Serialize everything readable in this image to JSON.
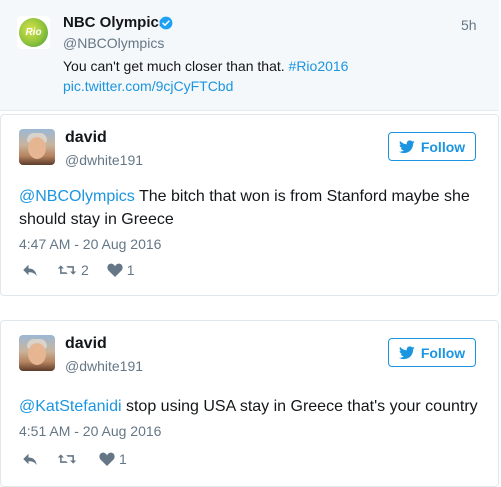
{
  "quoted_tweet": {
    "name": "NBC Olympics",
    "handle": "@NBCOlympics",
    "time": "5h",
    "text": "You can't get much closer than that. ",
    "hashtag": "#Rio2016",
    "link": "pic.twitter.com/9cjCyFTCbd",
    "avatar_text": "Rio"
  },
  "tweets": [
    {
      "name": "david",
      "handle": "@dwhite191",
      "follow_label": "Follow",
      "mention": "@NBCOlympics",
      "text": " The bitch that won is from Stanford maybe she should stay in Greece",
      "timestamp": "4:47 AM - 20 Aug 2016",
      "retweets": "2",
      "likes": "1"
    },
    {
      "name": "david",
      "handle": "@dwhite191",
      "follow_label": "Follow",
      "mention": "@KatStefanidi",
      "text": " stop using USA stay in Greece that's your country",
      "timestamp": "4:51 AM - 20 Aug 2016",
      "retweets": "",
      "likes": "1"
    }
  ],
  "colors": {
    "link": "#1b95e0",
    "muted": "#657786",
    "text": "#14171a"
  },
  "icons": [
    "verified-icon",
    "twitter-bird-icon",
    "reply-icon",
    "retweet-icon",
    "heart-icon"
  ]
}
